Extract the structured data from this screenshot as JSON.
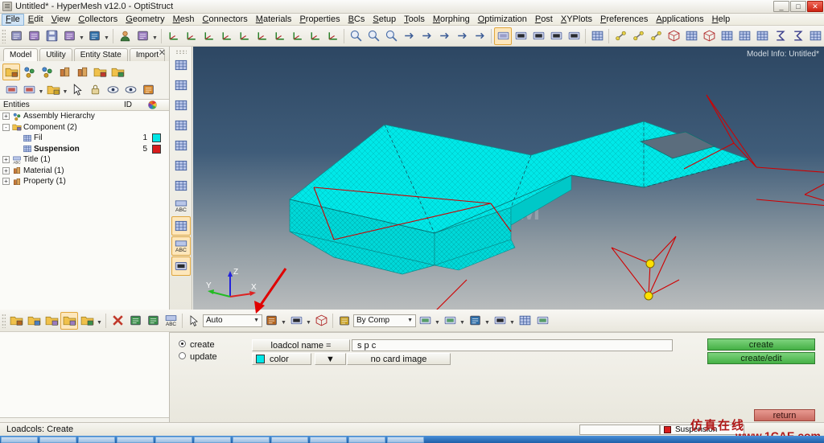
{
  "window": {
    "title": "Untitled* - HyperMesh v12.0 - OptiStruct",
    "minimize_label": "_",
    "maximize_label": "□",
    "close_label": "✕"
  },
  "menubar": {
    "items": [
      {
        "label": "File",
        "active": true
      },
      {
        "label": "Edit"
      },
      {
        "label": "View"
      },
      {
        "label": "Collectors"
      },
      {
        "label": "Geometry"
      },
      {
        "label": "Mesh"
      },
      {
        "label": "Connectors"
      },
      {
        "label": "Materials"
      },
      {
        "label": "Properties"
      },
      {
        "label": "BCs"
      },
      {
        "label": "Setup"
      },
      {
        "label": "Tools"
      },
      {
        "label": "Morphing"
      },
      {
        "label": "Optimization"
      },
      {
        "label": "Post"
      },
      {
        "label": "XYPlots"
      },
      {
        "label": "Preferences"
      },
      {
        "label": "Applications"
      },
      {
        "label": "Help"
      }
    ]
  },
  "toolbar_main": {
    "groups": [
      {
        "buttons": [
          {
            "name": "open-model-icon"
          },
          {
            "name": "import-model-icon"
          },
          {
            "name": "save-model-icon"
          },
          {
            "name": "import-solver-deck-icon",
            "arrow": true
          },
          {
            "name": "export-solver-deck-icon",
            "arrow": true
          }
        ]
      },
      {
        "buttons": [
          {
            "name": "user-profile-icon"
          },
          {
            "name": "color-scheme-icon",
            "arrow": true
          }
        ]
      },
      {
        "buttons": [
          {
            "name": "fit-view-icon"
          },
          {
            "name": "previous-view-icon"
          },
          {
            "name": "view-xy-icon"
          },
          {
            "name": "view-yx-icon"
          },
          {
            "name": "view-zx-icon"
          },
          {
            "name": "view-xz-icon"
          },
          {
            "name": "view-zy-icon"
          },
          {
            "name": "view-yz-icon"
          },
          {
            "name": "view-iso-icon"
          },
          {
            "name": "rotate-view-icon"
          }
        ]
      },
      {
        "buttons": [
          {
            "name": "zoom-out-icon"
          },
          {
            "name": "zoom-in-icon"
          },
          {
            "name": "circle-zoom-icon"
          },
          {
            "name": "pan-icon"
          },
          {
            "name": "arrow-left-icon"
          },
          {
            "name": "arrow-right-icon"
          },
          {
            "name": "arrow-updown-icon"
          },
          {
            "name": "rotate-free-icon"
          }
        ]
      },
      {
        "buttons": [
          {
            "name": "display-shaded-icon",
            "selected": true
          },
          {
            "name": "display-wireframe-icon"
          },
          {
            "name": "display-hidden-line-icon"
          },
          {
            "name": "display-transparent-icon"
          },
          {
            "name": "display-feature-icon"
          }
        ]
      },
      {
        "buttons": [
          {
            "name": "display-mesh-icon"
          }
        ]
      },
      {
        "buttons": [
          {
            "name": "connector-icon"
          },
          {
            "name": "weld-icon"
          },
          {
            "name": "bolt-icon"
          },
          {
            "name": "cube-outline-icon"
          },
          {
            "name": "cube-mesh-icon"
          },
          {
            "name": "cube-solid-icon"
          },
          {
            "name": "mesh-red-icon"
          },
          {
            "name": "mesh-blue-icon"
          },
          {
            "name": "mesh-arrow-icon"
          },
          {
            "name": "summation-icon"
          },
          {
            "name": "summation-alert-icon"
          },
          {
            "name": "matrix-icon"
          }
        ]
      }
    ]
  },
  "model_browser": {
    "tabs": [
      {
        "label": "Model",
        "active": true
      },
      {
        "label": "Utility",
        "active": false
      },
      {
        "label": "Entity State",
        "active": false
      },
      {
        "label": "Import",
        "active": false
      }
    ],
    "close_label": "✕",
    "toolbar_row1": [
      {
        "name": "new-folder-icon",
        "selected": true
      },
      {
        "name": "assembly-hierarchy-icon"
      },
      {
        "name": "component-icon"
      },
      {
        "name": "material-icon"
      },
      {
        "name": "property-icon"
      },
      {
        "name": "load-collector-icon"
      },
      {
        "name": "system-collector-icon"
      }
    ],
    "toolbar_row2": [
      {
        "name": "display-all-icon"
      },
      {
        "name": "component-display-icon",
        "arrow": true
      },
      {
        "name": "folder-display-icon",
        "arrow": true
      },
      {
        "name": "select-pointer-icon"
      },
      {
        "name": "lock-icon"
      },
      {
        "name": "show-hide-icon"
      },
      {
        "name": "isolate-icon"
      },
      {
        "name": "reverse-icon"
      }
    ],
    "columns": {
      "entities": "Entities",
      "id": "ID",
      "color": "color-wheel-icon"
    },
    "tree": [
      {
        "label": "Assembly Hierarchy",
        "expander": "+",
        "indent": 0,
        "icon": "assembly-icon",
        "id": "",
        "color": ""
      },
      {
        "label": "Component (2)",
        "expander": "-",
        "indent": 0,
        "icon": "component-folder-icon",
        "id": "",
        "color": ""
      },
      {
        "label": "Fil",
        "expander": "",
        "indent": 1,
        "icon": "component-mesh-icon",
        "id": "1",
        "color": "#00e5e5",
        "bold": false
      },
      {
        "label": "Suspension",
        "expander": "",
        "indent": 1,
        "icon": "component-mesh-icon",
        "id": "5",
        "color": "#d81c1c",
        "bold": true
      },
      {
        "label": "Title (1)",
        "expander": "+",
        "indent": 0,
        "icon": "title-icon",
        "id": "",
        "color": ""
      },
      {
        "label": "Material (1)",
        "expander": "+",
        "indent": 0,
        "icon": "material-icon",
        "id": "",
        "color": ""
      },
      {
        "label": "Property (1)",
        "expander": "+",
        "indent": 0,
        "icon": "property-icon",
        "id": "",
        "color": ""
      }
    ]
  },
  "vertical_toolbar": {
    "buttons": [
      {
        "name": "mesh-edit-icon"
      },
      {
        "name": "mesh-check-icon"
      },
      {
        "name": "mesh-plain-icon"
      },
      {
        "name": "mesh-grid-icon"
      },
      {
        "name": "mesh-window-icon"
      },
      {
        "name": "mesh-circle-icon"
      },
      {
        "name": "mesh-fold-icon"
      },
      {
        "name": "node-number-icon"
      },
      {
        "name": "element-abc-icon",
        "selected": true
      },
      {
        "name": "load-abc-icon",
        "selected": true
      },
      {
        "name": "surface-icon",
        "selected": true
      }
    ]
  },
  "viewport": {
    "model_info": "Model Info: Untitled*",
    "watermark": "1CAE.COM",
    "axes": {
      "x": "X",
      "y": "Y",
      "z": "Z"
    },
    "mesh_color": "#00e8e8",
    "load_color": "#d00000",
    "node_marker_color": "#ffe000"
  },
  "toolbar_viewport": {
    "groups": [
      {
        "buttons": [
          {
            "name": "component-collector-icon"
          },
          {
            "name": "material-collector-icon"
          },
          {
            "name": "property-collector-icon"
          },
          {
            "name": "loadcollector-icon",
            "selected": true
          },
          {
            "name": "system-collector-icon",
            "arrow": true
          }
        ]
      },
      {
        "buttons": [
          {
            "name": "delete-icon"
          },
          {
            "name": "organize-icon"
          },
          {
            "name": "reorder-icon"
          },
          {
            "name": "renumber-icon"
          }
        ]
      }
    ],
    "auto_select": {
      "label": "Auto",
      "name": "selection-mode-dropdown"
    },
    "shape_buttons": [
      {
        "name": "by-shape-icon",
        "arrow": true
      },
      {
        "name": "by-surface-icon",
        "arrow": true
      },
      {
        "name": "by-solid-icon"
      }
    ],
    "by_comp": {
      "label": "By Comp",
      "name": "color-mode-dropdown"
    },
    "right_buttons": [
      {
        "name": "wireframe-mode-icon",
        "arrow": true
      },
      {
        "name": "shaded-mode-icon",
        "arrow": true
      },
      {
        "name": "feature-edge-icon",
        "arrow": true
      },
      {
        "name": "surface-mode-icon",
        "arrow": true
      },
      {
        "name": "element-cluster-icon"
      },
      {
        "name": "monitor-icon"
      }
    ]
  },
  "panel": {
    "create_radio": {
      "label": "create",
      "selected": true
    },
    "update_radio": {
      "label": "update",
      "selected": false
    },
    "loadcol_name_label": "loadcol name =",
    "loadcol_name_value": "s p c",
    "color_label": "color",
    "color_value": "#00e8e8",
    "card_image_label": "no card image",
    "dropdown_arrow": "▼",
    "create_button": "create",
    "create_edit_button": "create/edit",
    "return_button": "return"
  },
  "statusbar": {
    "message": "Loadcols: Create",
    "current_collector": "Suspension",
    "current_collector_color": "#d81c1c",
    "entry_field": ""
  },
  "watermarks": {
    "chinese": "仿真在线",
    "url": "www.1CAE.com"
  },
  "taskbar": {
    "items": [
      "task-1",
      "task-2",
      "task-3",
      "task-4",
      "task-5",
      "task-6",
      "task-7",
      "task-8",
      "task-9",
      "task-10",
      "task-11"
    ]
  }
}
